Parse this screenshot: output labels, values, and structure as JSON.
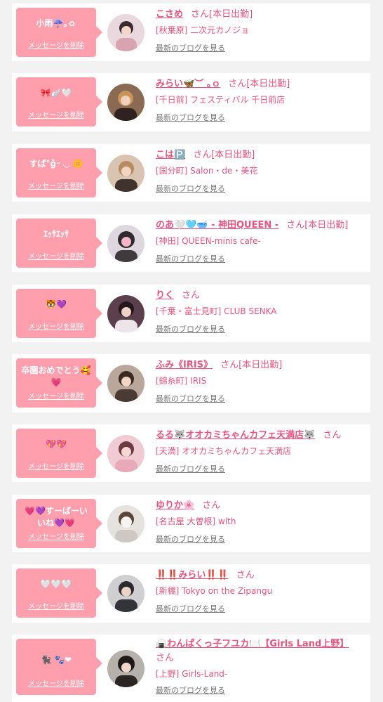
{
  "labels": {
    "delete_message": "メッセージを削除",
    "view_blog": "最新のブログを見る"
  },
  "colors": {
    "accent": "#e8547d",
    "bubble": "#ff9fae",
    "background": "#f2f2f2",
    "card": "#ffffff",
    "muted": "#777777"
  },
  "entries": [
    {
      "message": "小雨☔️｡ｏ",
      "name": "こさめ",
      "suffix": "さん[本日出勤]",
      "shop": "[秋葉原] 二次元カノジョ"
    },
    {
      "message": "🎀🪽🤍",
      "name": "みらい🦋︶ ｡ｏ",
      "suffix": "さん[本日出勤]",
      "shop": "[千日前] フェスティバル 千日前店"
    },
    {
      "message": "すぱ°ɡ̊ᵕ ◡ 🌼",
      "name": "こは🅿️",
      "suffix": "さん[本日出勤]",
      "shop": "[国分町] Salon・de・美花"
    },
    {
      "message": "ｴｯｻｴｯｻ",
      "name": "のあ🤍🩵🥣 - 神田QUEEN -",
      "suffix": "さん[本日出勤]",
      "shop": "[神田] QUEEN-minis cafe-"
    },
    {
      "message": "🐯💜",
      "name": "りく",
      "suffix": "さん",
      "shop": "[千葉・富士見町] CLUB SENKA"
    },
    {
      "message": "卒園おめでとう🥰\n💗",
      "name": "ふみ《IRIS》",
      "suffix": "さん[本日出勤]",
      "shop": "[錦糸町] IRIS"
    },
    {
      "message": "💖💖",
      "name": "るる🐺オオカミちゃんカフェ天満店🐺",
      "suffix": "さん",
      "shop": "[天満] オオカミちゃんカフェ天満店"
    },
    {
      "message": "💗💜すーぱーい\nいね💜💗",
      "name": "ゆりか🌸",
      "suffix": "さん",
      "shop": "[名古屋 大曽根] with"
    },
    {
      "message": "🤍🤍🤍",
      "name": "‼️‼️みらい‼️‼️",
      "suffix": "さん",
      "shop": "[新橋] Tokyo on the Zipangu"
    },
    {
      "message": "🐈‍⬛ 🐾❤",
      "name": "🍙わんぱくっ子フユカ🍽️【Girls Land上野】",
      "suffix": "さん",
      "shop": "[上野] Girls-Land-"
    }
  ]
}
